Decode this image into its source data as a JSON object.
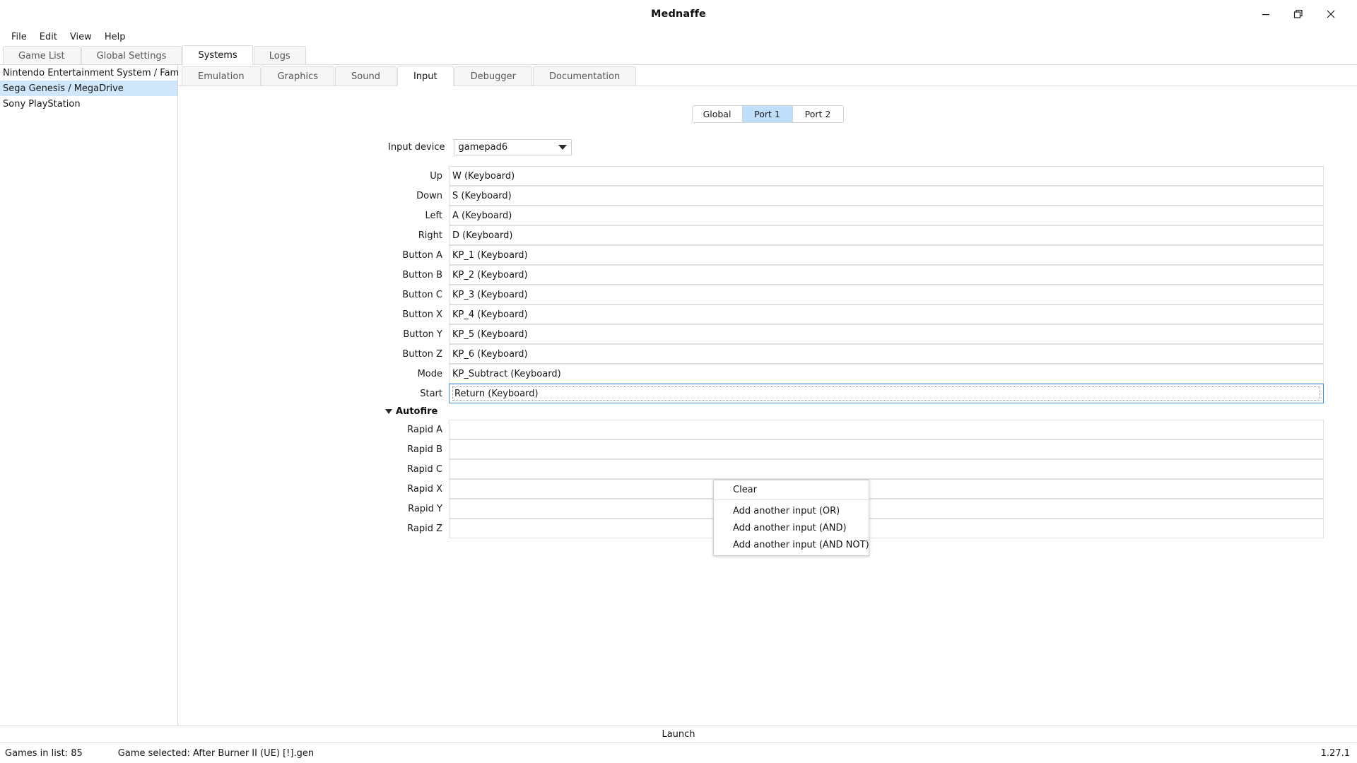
{
  "window": {
    "title": "Mednaffe",
    "controls": {
      "minimize": "minimize-icon",
      "restore": "restore-icon",
      "close": "close-icon"
    }
  },
  "menubar": {
    "items": [
      "File",
      "Edit",
      "View",
      "Help"
    ]
  },
  "main_tabs": {
    "items": [
      "Game List",
      "Global Settings",
      "Systems",
      "Logs"
    ],
    "active": "Systems"
  },
  "sidebar": {
    "items": [
      "Nintendo Entertainment System / Famicom",
      "Sega Genesis / MegaDrive",
      "Sony PlayStation"
    ],
    "selected": "Sega Genesis / MegaDrive"
  },
  "sub_tabs": {
    "items": [
      "Emulation",
      "Graphics",
      "Sound",
      "Input",
      "Debugger",
      "Documentation"
    ],
    "active": "Input"
  },
  "port_selector": {
    "options": [
      "Global",
      "Port 1",
      "Port 2"
    ],
    "active": "Port 1",
    "active_color": "#bfdffb"
  },
  "input_device": {
    "label": "Input device",
    "value": "gamepad6",
    "arrow": "chevron-down-icon"
  },
  "bindings": [
    {
      "label": "Up",
      "value": "W (Keyboard)"
    },
    {
      "label": "Down",
      "value": "S (Keyboard)"
    },
    {
      "label": "Left",
      "value": "A (Keyboard)"
    },
    {
      "label": "Right",
      "value": "D (Keyboard)"
    },
    {
      "label": "Button A",
      "value": "KP_1 (Keyboard)"
    },
    {
      "label": "Button B",
      "value": "KP_2 (Keyboard)"
    },
    {
      "label": "Button C",
      "value": "KP_3 (Keyboard)"
    },
    {
      "label": "Button X",
      "value": "KP_4 (Keyboard)"
    },
    {
      "label": "Button Y",
      "value": "KP_5 (Keyboard)"
    },
    {
      "label": "Button Z",
      "value": "KP_6 (Keyboard)"
    },
    {
      "label": "Mode",
      "value": "KP_Subtract (Keyboard)"
    },
    {
      "label": "Start",
      "value": "Return (Keyboard)"
    }
  ],
  "autofire": {
    "title": "Autofire",
    "expander": "triangle-down-icon",
    "bindings": [
      {
        "label": "Rapid A",
        "value": ""
      },
      {
        "label": "Rapid B",
        "value": ""
      },
      {
        "label": "Rapid C",
        "value": ""
      },
      {
        "label": "Rapid X",
        "value": ""
      },
      {
        "label": "Rapid Y",
        "value": ""
      },
      {
        "label": "Rapid Z",
        "value": ""
      }
    ]
  },
  "context_menu": {
    "items": [
      "Clear",
      "Add another input (OR)",
      "Add another input (AND)",
      "Add another input (AND NOT)"
    ]
  },
  "launch": {
    "label": "Launch"
  },
  "status": {
    "games_in_list": "Games in list: 85",
    "game_selected": "Game selected: After Burner II (UE) [!].gen",
    "version": "1.27.1"
  }
}
